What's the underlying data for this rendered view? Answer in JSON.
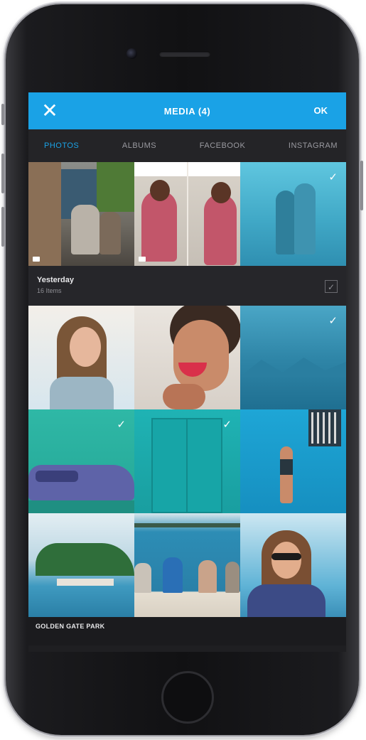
{
  "header": {
    "title": "MEDIA (4)",
    "ok_label": "OK",
    "close_icon": "close-icon"
  },
  "tabs": [
    {
      "label": "PHOTOS",
      "active": true
    },
    {
      "label": "ALBUMS",
      "active": false
    },
    {
      "label": "FACEBOOK",
      "active": false
    },
    {
      "label": "INSTAGRAM",
      "active": false
    }
  ],
  "section_yesterday": {
    "title": "Yesterday",
    "subtitle": "16 Items"
  },
  "section_bottom": {
    "title": "GOLDEN GATE PARK"
  },
  "colors": {
    "accent": "#1aa2e6",
    "screen_bg": "#1f1f22"
  },
  "selected_photos": 4
}
